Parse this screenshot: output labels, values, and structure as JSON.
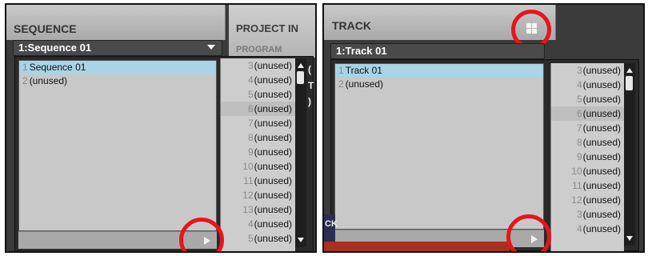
{
  "left_panel": {
    "title": "SEQUENCE",
    "side_title": "PROJECT IN",
    "side_sub": "PROGRAM",
    "dropdown_value": "1:Sequence 01",
    "main_list": [
      {
        "num": "1",
        "label": "Sequence 01",
        "selected": true
      },
      {
        "num": "2",
        "label": "(unused)",
        "selected": false
      }
    ],
    "side_list": [
      {
        "num": "3",
        "label": "(unused)"
      },
      {
        "num": "4",
        "label": "(unused)"
      },
      {
        "num": "5",
        "label": "(unused)"
      },
      {
        "num": "6",
        "label": "(unused)"
      },
      {
        "num": "7",
        "label": "(unused)"
      },
      {
        "num": "8",
        "label": "(unused)"
      },
      {
        "num": "9",
        "label": "(unused)"
      },
      {
        "num": "10",
        "label": "(unused)"
      },
      {
        "num": "11",
        "label": "(unused)"
      },
      {
        "num": "12",
        "label": "(unused)"
      },
      {
        "num": "13",
        "label": "(unused)"
      },
      {
        "num": "4",
        "label": "(unused)"
      },
      {
        "num": "5",
        "label": "(unused)"
      }
    ],
    "peek_text": [
      "(",
      "T",
      ")"
    ]
  },
  "right_panel": {
    "title": "TRACK",
    "dropdown_value": "1:Track 01",
    "main_list": [
      {
        "num": "1",
        "label": "Track 01",
        "selected": true
      },
      {
        "num": "2",
        "label": "(unused)",
        "selected": false
      }
    ],
    "side_list": [
      {
        "num": "3",
        "label": "(unused)"
      },
      {
        "num": "4",
        "label": "(unused)"
      },
      {
        "num": "5",
        "label": "(unused)"
      },
      {
        "num": "6",
        "label": "(unused)"
      },
      {
        "num": "7",
        "label": "(unused)"
      },
      {
        "num": "8",
        "label": "(unused)"
      },
      {
        "num": "9",
        "label": "(unused)"
      },
      {
        "num": "10",
        "label": "(unused)"
      },
      {
        "num": "11",
        "label": "(unused)"
      },
      {
        "num": "12",
        "label": "(unused)"
      },
      {
        "num": "3",
        "label": "(unused)"
      },
      {
        "num": "4",
        "label": "(unused)"
      }
    ],
    "bottom_left_text": "CK"
  },
  "colors": {
    "highlight_circle": "#e8141a",
    "selected_row": "#a8d4e6",
    "panel_bg": "#3b3b3b"
  }
}
